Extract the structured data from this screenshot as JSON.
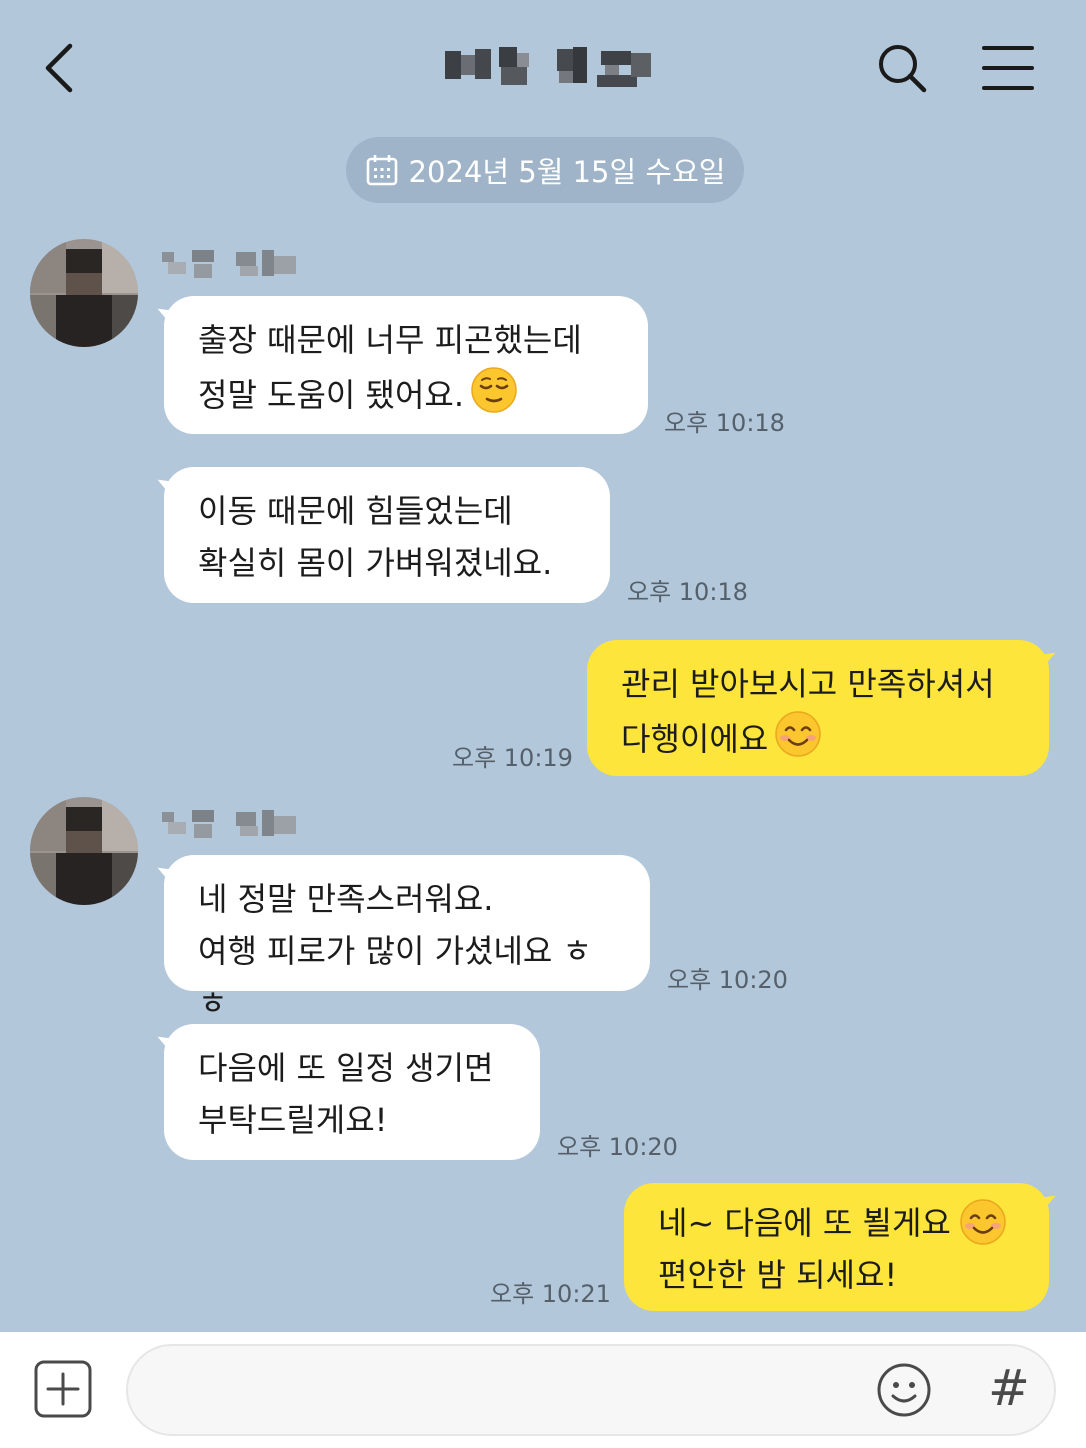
{
  "date_divider": "2024년 5월 15일 수요일",
  "icons": [
    "back-arrow-icon",
    "search-icon",
    "menu-icon",
    "calendar-icon",
    "plus-icon",
    "emoji-icon",
    "hash-icon"
  ],
  "messages": [
    {
      "side": "in",
      "text": "출장 때문에 너무 피곤했는데\n정말 도움이 됐어요.",
      "emoji": "relieved-face",
      "time": "오후 10:18"
    },
    {
      "side": "in",
      "text": "이동 때문에 힘들었는데\n확실히 몸이 가벼워졌네요.",
      "time": "오후 10:18"
    },
    {
      "side": "out",
      "text": "관리 받아보시고 만족하셔서\n다행이에요",
      "emoji": "smiling-face",
      "time": "오후 10:19"
    },
    {
      "side": "in",
      "text": "네 정말 만족스러워요.\n여행 피로가 많이 가셨네요 ㅎㅎ",
      "time": "오후 10:20"
    },
    {
      "side": "in",
      "text": "다음에 또 일정 생기면\n부탁드릴게요!",
      "time": "오후 10:20"
    },
    {
      "side": "out",
      "text": "네~ 다음에 또 뵐게요\n편안한 밤 되세요!",
      "emoji": "smiling-face",
      "time": "오후 10:21"
    }
  ],
  "input": {
    "hash_label": "#"
  },
  "colors": {
    "background": "#b2c7da",
    "incoming_bubble": "#ffffff",
    "outgoing_bubble": "#fde53c",
    "date_pill": "#9fb4c8"
  }
}
